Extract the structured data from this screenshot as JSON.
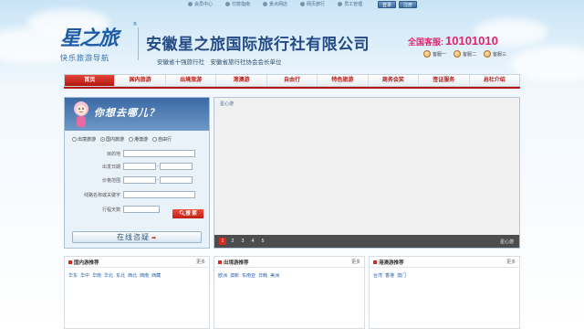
{
  "topbar": {
    "links": [
      "会员中心",
      "付款指南",
      "景点网店",
      "网页旅行",
      "员工管理"
    ],
    "login_label": "登录",
    "register_label": "注册"
  },
  "header": {
    "logo_text": "星之旅",
    "logo_reg": "®",
    "slogan": "快乐旅游导航",
    "company_name": "安徽星之旅国际旅行社有限公司",
    "company_sub": "安徽省十强旅行社　安徽省旅行社协会会长单位",
    "hotline_label": "全国客服:",
    "hotline_number": "10101010",
    "services": [
      "客服一",
      "客服二",
      "客服三"
    ]
  },
  "nav": {
    "items": [
      "首页",
      "国内旅游",
      "出境旅游",
      "港澳游",
      "自由行",
      "特色旅游",
      "商务会奖",
      "签证服务",
      "总社介绍"
    ],
    "active_index": 0
  },
  "search": {
    "title": "你想去哪儿？",
    "radios": [
      "出境旅游",
      "国内旅游",
      "港澳游",
      "自由行"
    ],
    "selected_radio": 1,
    "fields": {
      "destination": "目的地",
      "departure_date": "出发日期",
      "price_range": "价格范围",
      "keyword": "线路名称或关键字",
      "days": "行程天数"
    },
    "range_sep": "-",
    "search_button": "搜 索",
    "consult_button": "在线咨疑"
  },
  "banner": {
    "alt_text": "星心游",
    "pages": [
      "1",
      "2",
      "3",
      "4",
      "5"
    ],
    "active_page": 0,
    "caption": "星心游"
  },
  "recommend": [
    {
      "title": "国内游推荐",
      "more": "更多",
      "links": [
        "华东",
        "华中",
        "华南",
        "华北",
        "东北",
        "西北",
        "西南",
        "西藏"
      ]
    },
    {
      "title": "出境游推荐",
      "more": "更多",
      "links": [
        "欧洲",
        "澳新",
        "东南亚",
        "日韩",
        "美洲"
      ]
    },
    {
      "title": "港澳游推荐",
      "more": "更多",
      "links": [
        "台湾",
        "香港",
        "澳门"
      ]
    }
  ]
}
